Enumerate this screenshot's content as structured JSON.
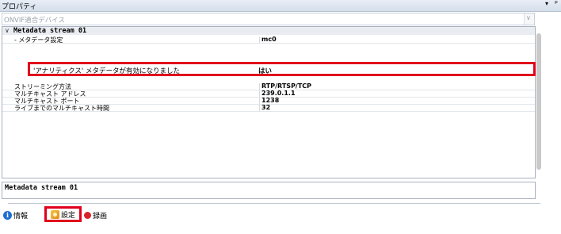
{
  "titlebar": {
    "title": "プロパティ",
    "menu_arrow": "▾",
    "pin": "ᵖ"
  },
  "device_select": {
    "value": "ONVIF適合デバイス"
  },
  "group": {
    "name": "Metadata stream 01"
  },
  "rows": [
    {
      "label": "- メタデータ設定",
      "value": "mc0"
    },
    {
      "label": "ストリーミング方法",
      "value": "RTP/RTSP/TCP"
    },
    {
      "label": "マルチキャスト アドレス",
      "value": "239.0.1.1"
    },
    {
      "label": "マルチキャスト ポート",
      "value": "1238"
    },
    {
      "label": "ライブまでのマルチキャスト時間",
      "value": "32"
    }
  ],
  "highlight_row": {
    "label": "'アナリティクス' メタデータが有効になりました",
    "value": "はい"
  },
  "description": {
    "title": "Metadata stream 01"
  },
  "tabs": {
    "info": "情報",
    "settings": "設定",
    "record": "録画"
  },
  "colors": {
    "highlight": "#e0001b",
    "titlebar": "#dce4ef"
  }
}
